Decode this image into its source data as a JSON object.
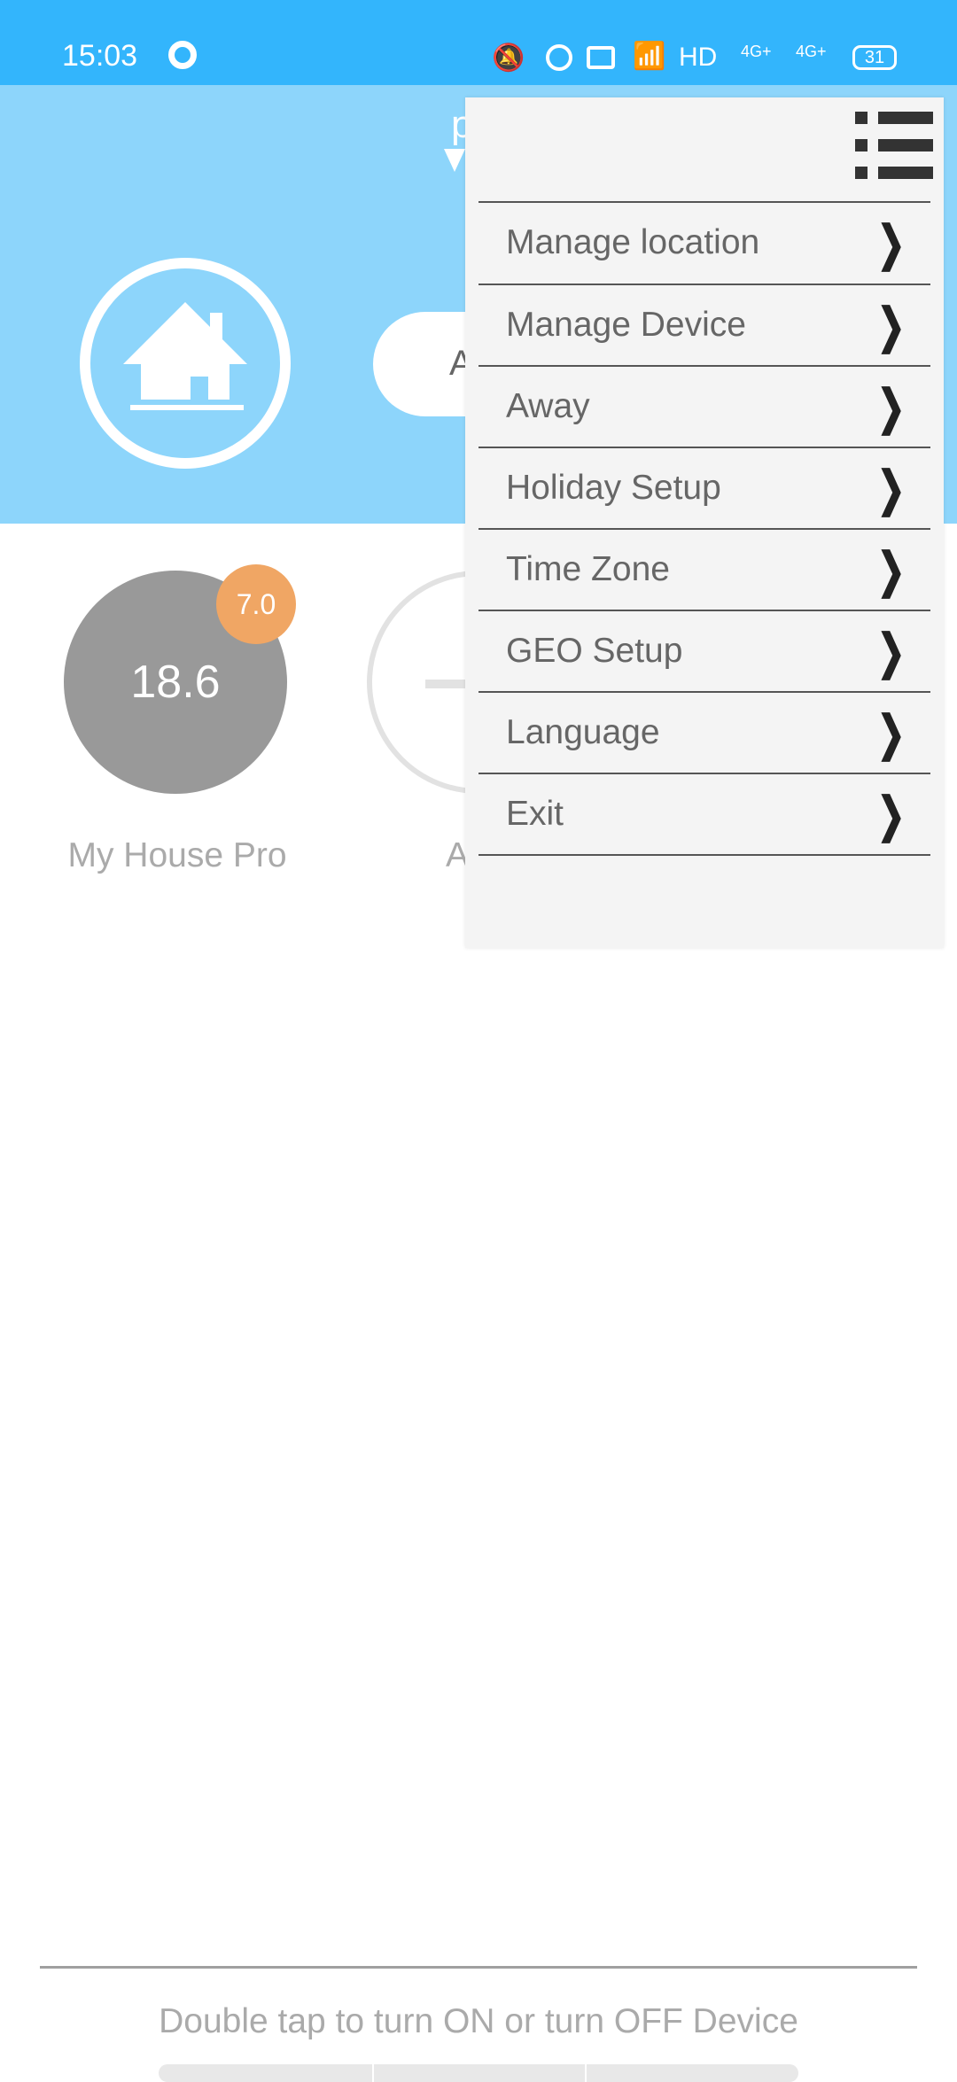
{
  "status_bar": {
    "time": "15:03",
    "battery": "31",
    "network": "4G+",
    "hd": "HD"
  },
  "header": {
    "location_initial": "p",
    "mode_initial": "A"
  },
  "devices": [
    {
      "name": "My House Pro",
      "temperature": "18.6",
      "set_point": "7.0",
      "state": "on"
    },
    {
      "name": "A",
      "state": "off"
    }
  ],
  "menu": {
    "items": [
      {
        "label": "Manage location"
      },
      {
        "label": "Manage Device"
      },
      {
        "label": "Away"
      },
      {
        "label": "Holiday Setup"
      },
      {
        "label": "Time Zone"
      },
      {
        "label": "GEO Setup"
      },
      {
        "label": "Language"
      },
      {
        "label": "Exit"
      }
    ]
  },
  "footer": {
    "hint": "Double tap to turn ON or turn OFF Device"
  },
  "colors": {
    "status_bar": "#33b5fc",
    "header": "#8dd5fb",
    "badge": "#f0a664",
    "device_on": "#999999"
  }
}
